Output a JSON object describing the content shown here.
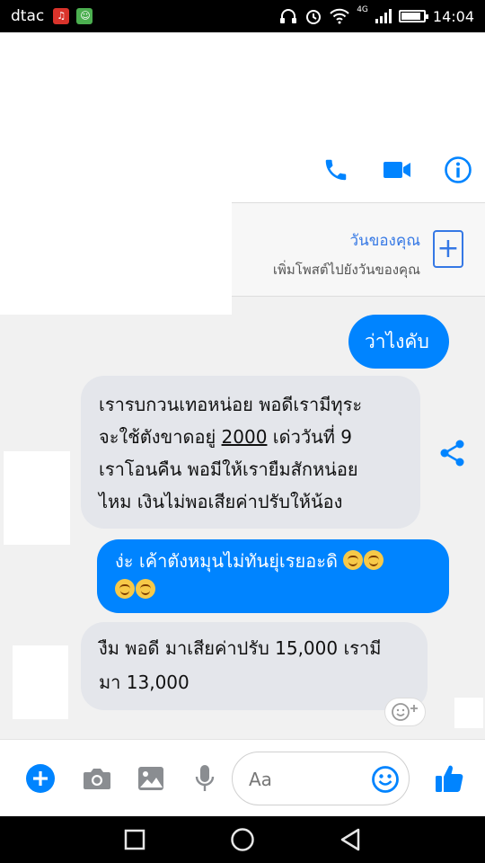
{
  "status_bar": {
    "carrier": "dtac",
    "network": "4G",
    "time": "14:04",
    "battery_level": 0.8,
    "icons": [
      "music-app-icon",
      "chat-app-icon",
      "headphones-icon",
      "alarm-icon",
      "wifi-icon",
      "signal-icon",
      "battery-icon"
    ]
  },
  "header": {
    "icons": [
      "phone-icon",
      "video-call-icon",
      "info-icon"
    ],
    "accent_color": "#0084ff"
  },
  "your_day": {
    "title": "วันของคุณ",
    "subtitle": "เพิ่มโพสต์ไปยังวันของคุณ",
    "add_symbol": "+"
  },
  "messages": [
    {
      "direction": "outgoing",
      "text": "ว่าไงคับ"
    },
    {
      "direction": "incoming",
      "line1": "เรารบกวนเทอหน่อย พอดีเรามีทุระ",
      "line2_pre": "จะใช้ตังขาดอยู่ ",
      "line2_amount": "2000",
      "line2_post": " เด่ววันที่ 9",
      "line3": "เราโอนคืน พอมีให้เรายืมสักหน่อย",
      "line4": "ไหม เงินไม่พอเสียค่าปรับให้น้อง"
    },
    {
      "direction": "outgoing",
      "text": "ง่ะ เค้าตังหมุนไม่ทันยุ่เรยอะดิ",
      "emoji": "laughing-emoji"
    },
    {
      "direction": "incoming",
      "line1": "งืม พอดี มาเสียค่าปรับ 15,000 เรามี",
      "line2": "มา 13,000"
    }
  ],
  "composer": {
    "placeholder": "Aa",
    "icons": [
      "add-icon",
      "camera-icon",
      "gallery-icon",
      "microphone-icon",
      "emoji-icon",
      "thumbs-up-icon"
    ]
  },
  "navbar": {
    "icons": [
      "recent-apps-icon",
      "home-icon",
      "back-icon"
    ]
  },
  "colors": {
    "messenger_blue": "#0084ff",
    "incoming_bubble": "#e4e6eb",
    "background": "#f1f1f1"
  }
}
